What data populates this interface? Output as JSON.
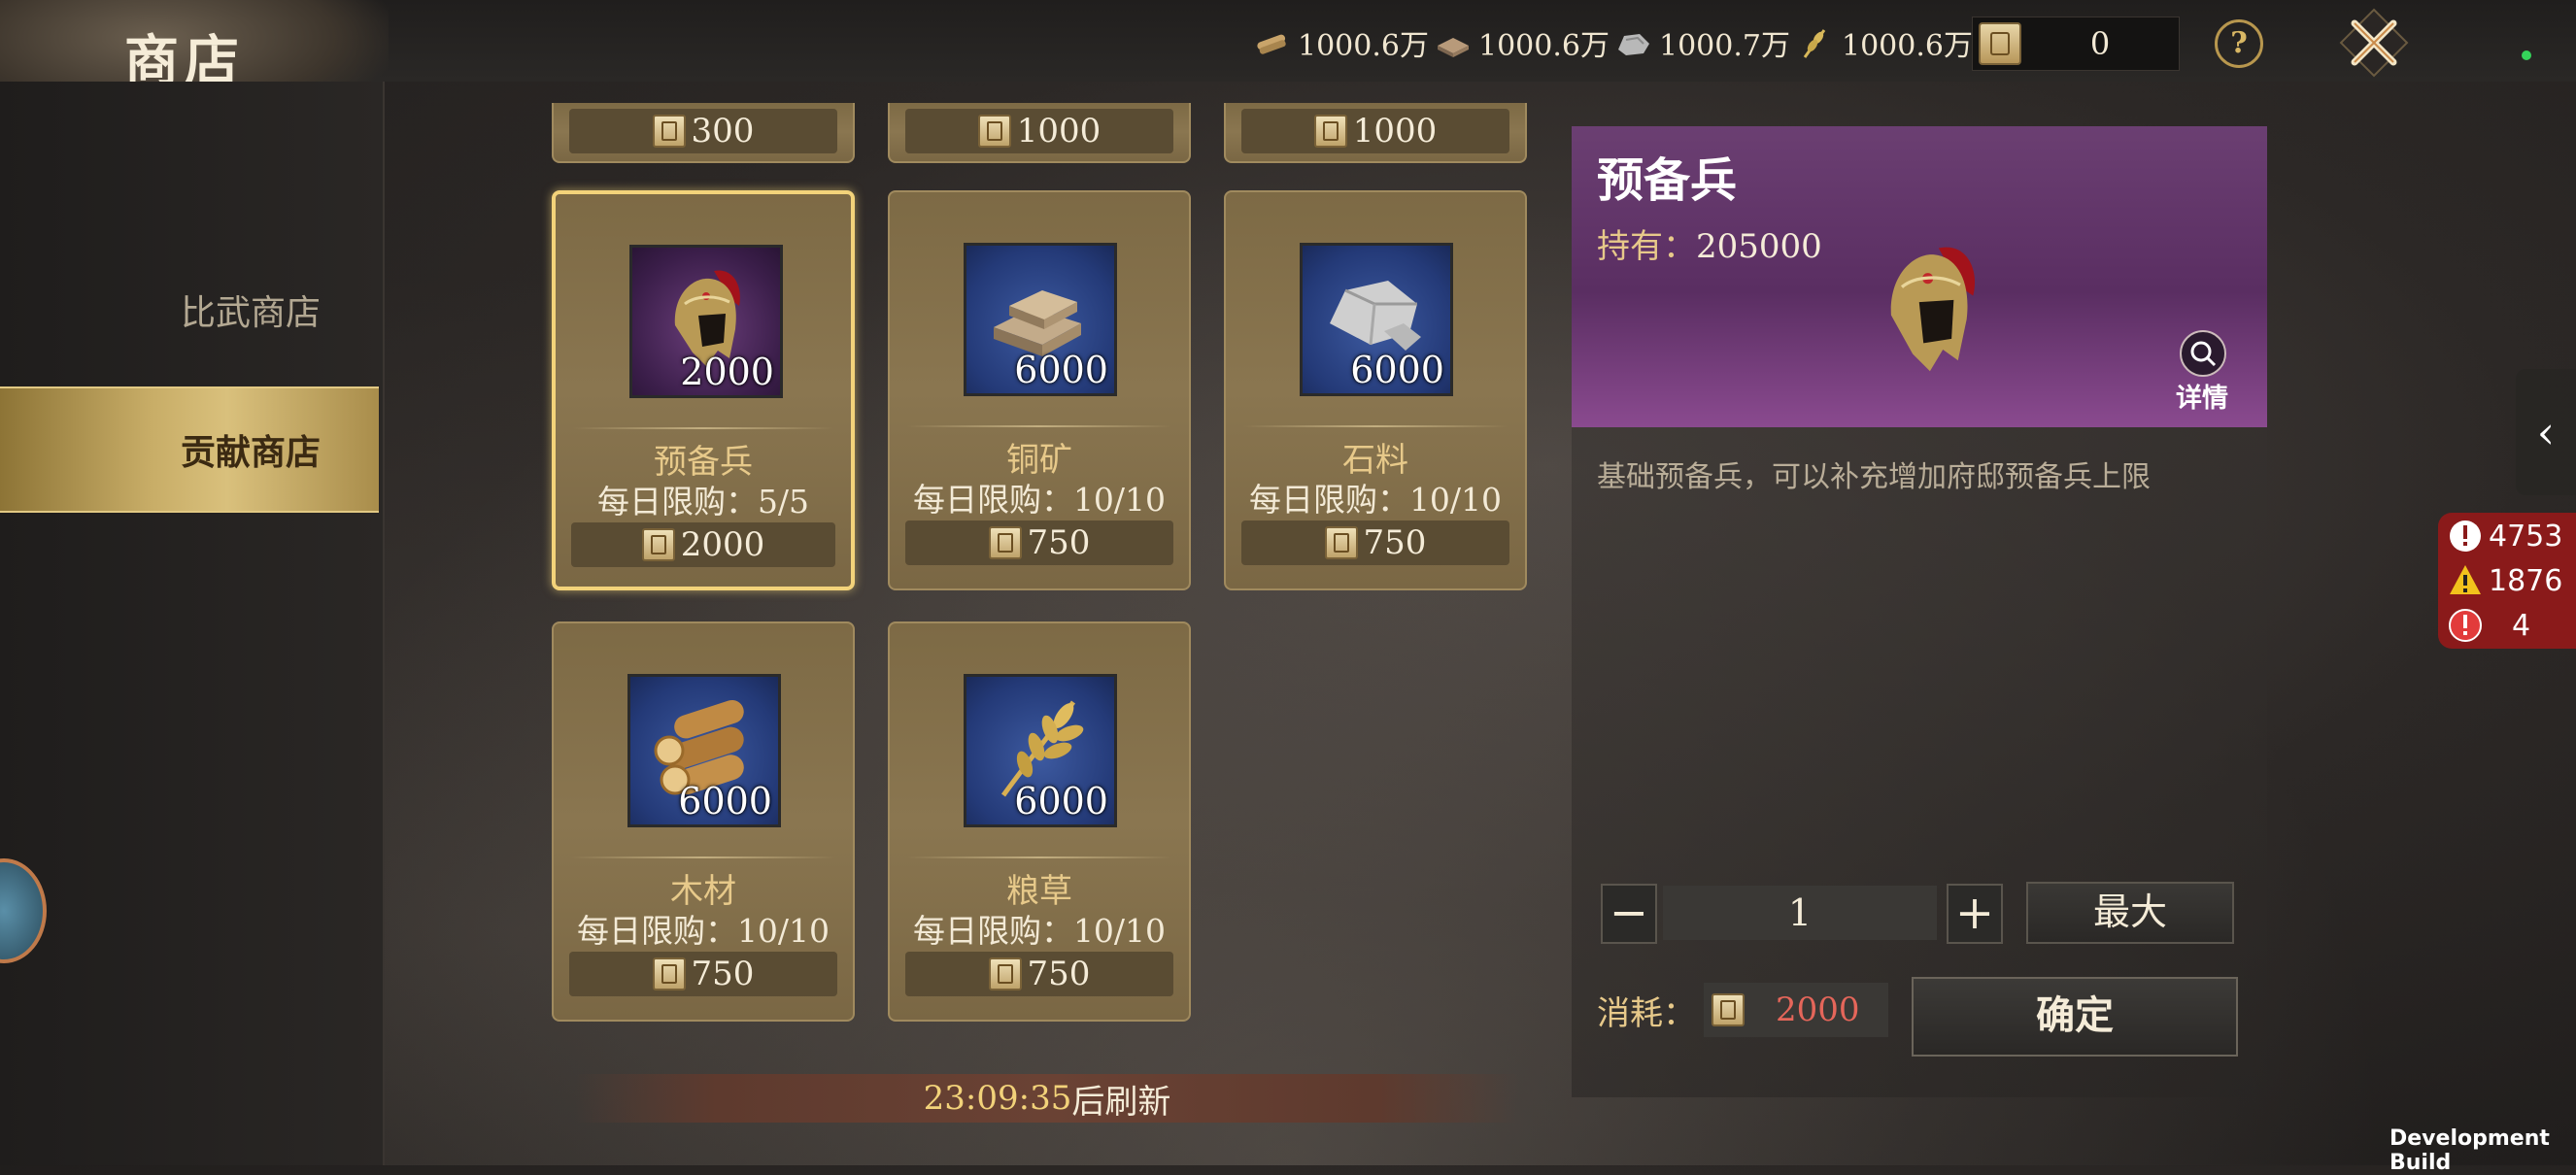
{
  "header": {
    "title": "商店",
    "resources": [
      {
        "icon": "wood-icon",
        "value": "1000.6万"
      },
      {
        "icon": "copper-icon",
        "value": "1000.6万"
      },
      {
        "icon": "stone-icon",
        "value": "1000.7万"
      },
      {
        "icon": "grain-icon",
        "value": "1000.6万"
      }
    ],
    "contribution_currency": "0",
    "help_label": "?"
  },
  "sidebar": {
    "items": [
      {
        "label": "比武商店",
        "active": false
      },
      {
        "label": "贡献商店",
        "active": true
      }
    ]
  },
  "shop": {
    "top_partial_prices": [
      "300",
      "1000",
      "1000"
    ],
    "items": [
      {
        "name": "预备兵",
        "qty": "2000",
        "limit": "每日限购：5/5",
        "price": "2000",
        "icon": "helmet-icon",
        "bg": "purple",
        "selected": true
      },
      {
        "name": "铜矿",
        "qty": "6000",
        "limit": "每日限购：10/10",
        "price": "750",
        "icon": "copper-ingot-icon",
        "bg": "blue",
        "selected": false
      },
      {
        "name": "石料",
        "qty": "6000",
        "limit": "每日限购：10/10",
        "price": "750",
        "icon": "stone-icon",
        "bg": "blue",
        "selected": false
      },
      {
        "name": "木材",
        "qty": "6000",
        "limit": "每日限购：10/10",
        "price": "750",
        "icon": "logs-icon",
        "bg": "blue",
        "selected": false
      },
      {
        "name": "粮草",
        "qty": "6000",
        "limit": "每日限购：10/10",
        "price": "750",
        "icon": "wheat-icon",
        "bg": "blue",
        "selected": false
      }
    ],
    "refresh_time": "23:09:35",
    "refresh_suffix": "后刷新"
  },
  "detail": {
    "title": "预备兵",
    "own_label": "持有：",
    "own_value": "205000",
    "details_label": "详情",
    "description": "基础预备兵，可以补充增加府邸预备兵上限",
    "quantity": "1",
    "minus": "−",
    "plus": "+",
    "max_label": "最大",
    "cost_label": "消耗：",
    "cost_value": "2000",
    "confirm_label": "确定"
  },
  "alerts": [
    {
      "icon": "info-icon",
      "value": "4753"
    },
    {
      "icon": "warning-icon",
      "value": "1876"
    },
    {
      "icon": "error-icon",
      "value": "4"
    }
  ],
  "footer": {
    "build_label": "Development Build"
  },
  "colors": {
    "accent_gold": "#e7c98a",
    "cost_red": "#e5665a",
    "active_tab": "#c8ad67"
  }
}
